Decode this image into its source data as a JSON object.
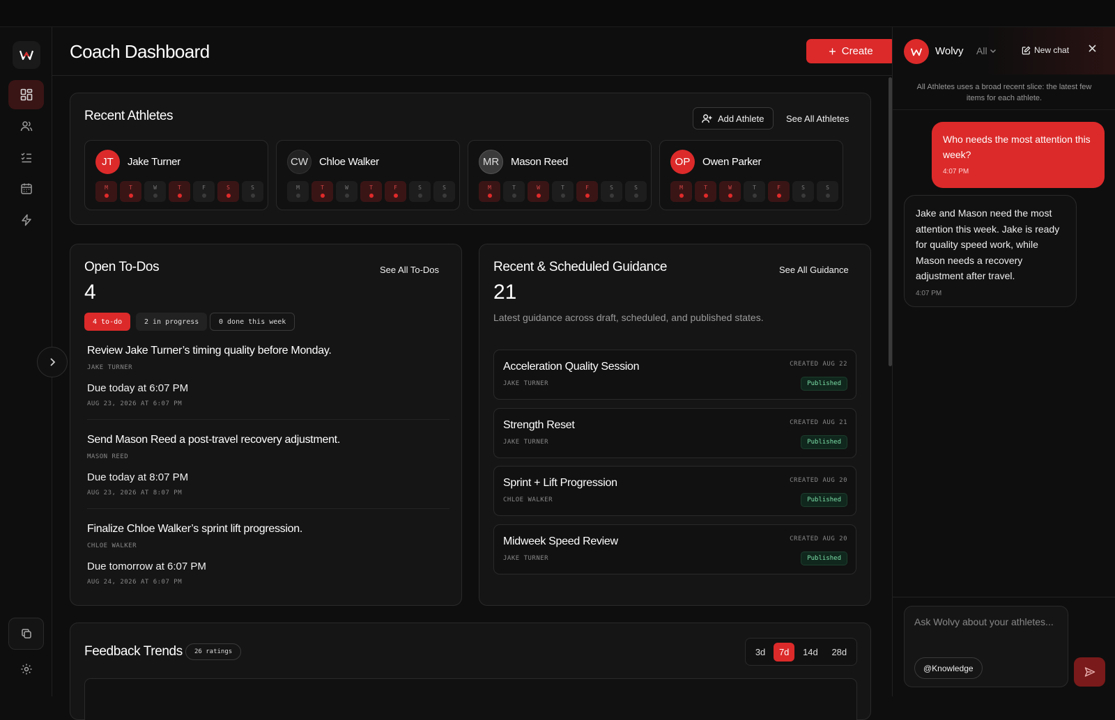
{
  "header": {
    "title": "Coach Dashboard",
    "create_label": "Create"
  },
  "recent_athletes": {
    "title": "Recent Athletes",
    "add_label": "Add Athlete",
    "see_all_label": "See All Athletes",
    "athletes": [
      {
        "initials": "JT",
        "name": "Jake Turner",
        "avatar_style": "red",
        "days": [
          {
            "l": "M",
            "on": true
          },
          {
            "l": "T",
            "on": true
          },
          {
            "l": "W",
            "on": false
          },
          {
            "l": "T",
            "on": true
          },
          {
            "l": "F",
            "on": false
          },
          {
            "l": "S",
            "on": true
          },
          {
            "l": "S",
            "on": false
          }
        ]
      },
      {
        "initials": "CW",
        "name": "Chloe Walker",
        "avatar_style": "dark",
        "days": [
          {
            "l": "M",
            "on": false
          },
          {
            "l": "T",
            "on": true
          },
          {
            "l": "W",
            "on": false
          },
          {
            "l": "T",
            "on": true
          },
          {
            "l": "F",
            "on": true
          },
          {
            "l": "S",
            "on": false
          },
          {
            "l": "S",
            "on": false
          }
        ]
      },
      {
        "initials": "MR",
        "name": "Mason Reed",
        "avatar_style": "gray",
        "days": [
          {
            "l": "M",
            "on": true
          },
          {
            "l": "T",
            "on": false
          },
          {
            "l": "W",
            "on": true
          },
          {
            "l": "T",
            "on": false
          },
          {
            "l": "F",
            "on": true
          },
          {
            "l": "S",
            "on": false
          },
          {
            "l": "S",
            "on": false
          }
        ]
      },
      {
        "initials": "OP",
        "name": "Owen Parker",
        "avatar_style": "red",
        "days": [
          {
            "l": "M",
            "on": true
          },
          {
            "l": "T",
            "on": true
          },
          {
            "l": "W",
            "on": true
          },
          {
            "l": "T",
            "on": false
          },
          {
            "l": "F",
            "on": true
          },
          {
            "l": "S",
            "on": false
          },
          {
            "l": "S",
            "on": false
          }
        ]
      }
    ]
  },
  "todos": {
    "title": "Open To-Dos",
    "see_all_label": "See All To-Dos",
    "count": "4",
    "pills": {
      "todo": "4 to-do",
      "in_progress": "2 in progress",
      "done": "0 done this week"
    },
    "items": [
      {
        "title": "Review Jake Turner’s timing quality before Monday.",
        "athlete": "JAKE TURNER",
        "due": "Due today at 6:07 PM",
        "date": "AUG 23, 2026 AT 6:07 PM"
      },
      {
        "title": "Send Mason Reed a post-travel recovery adjustment.",
        "athlete": "MASON REED",
        "due": "Due today at 8:07 PM",
        "date": "AUG 23, 2026 AT 8:07 PM"
      },
      {
        "title": "Finalize Chloe Walker’s sprint lift progression.",
        "athlete": "CHLOE WALKER",
        "due": "Due tomorrow at 6:07 PM",
        "date": "AUG 24, 2026 AT 6:07 PM"
      }
    ]
  },
  "guidance": {
    "title": "Recent & Scheduled Guidance",
    "see_all_label": "See All Guidance",
    "count": "21",
    "subtitle": "Latest guidance across draft, scheduled, and published states.",
    "items": [
      {
        "title": "Acceleration Quality Session",
        "athlete": "JAKE TURNER",
        "created": "CREATED AUG 22",
        "status": "Published"
      },
      {
        "title": "Strength Reset",
        "athlete": "JAKE TURNER",
        "created": "CREATED AUG 21",
        "status": "Published"
      },
      {
        "title": "Sprint + Lift Progression",
        "athlete": "CHLOE WALKER",
        "created": "CREATED AUG 20",
        "status": "Published"
      },
      {
        "title": "Midweek Speed Review",
        "athlete": "JAKE TURNER",
        "created": "CREATED AUG 20",
        "status": "Published"
      }
    ]
  },
  "feedback": {
    "title": "Feedback Trends",
    "ratings": "26 ratings",
    "ranges": [
      "3d",
      "7d",
      "14d",
      "28d"
    ],
    "selected_range": "7d"
  },
  "chat": {
    "name": "Wolvy",
    "scope": "All",
    "new_chat_label": "New chat",
    "note": "All Athletes uses a broad recent slice: the latest few items for each athlete.",
    "messages": {
      "user": {
        "text": "Who needs the most attention this week?",
        "time": "4:07 PM"
      },
      "bot": {
        "text": "Jake and Mason need the most attention this week. Jake is ready for quality speed work, while Mason needs a recovery adjustment after travel.",
        "time": "4:07 PM"
      }
    },
    "input_placeholder": "Ask Wolvy about your athletes...",
    "knowledge_label": "@Knowledge"
  },
  "colors": {
    "accent": "#dc2a2a",
    "background": "#0e0e0e",
    "card": "#151515",
    "published": "#7be0a8"
  }
}
